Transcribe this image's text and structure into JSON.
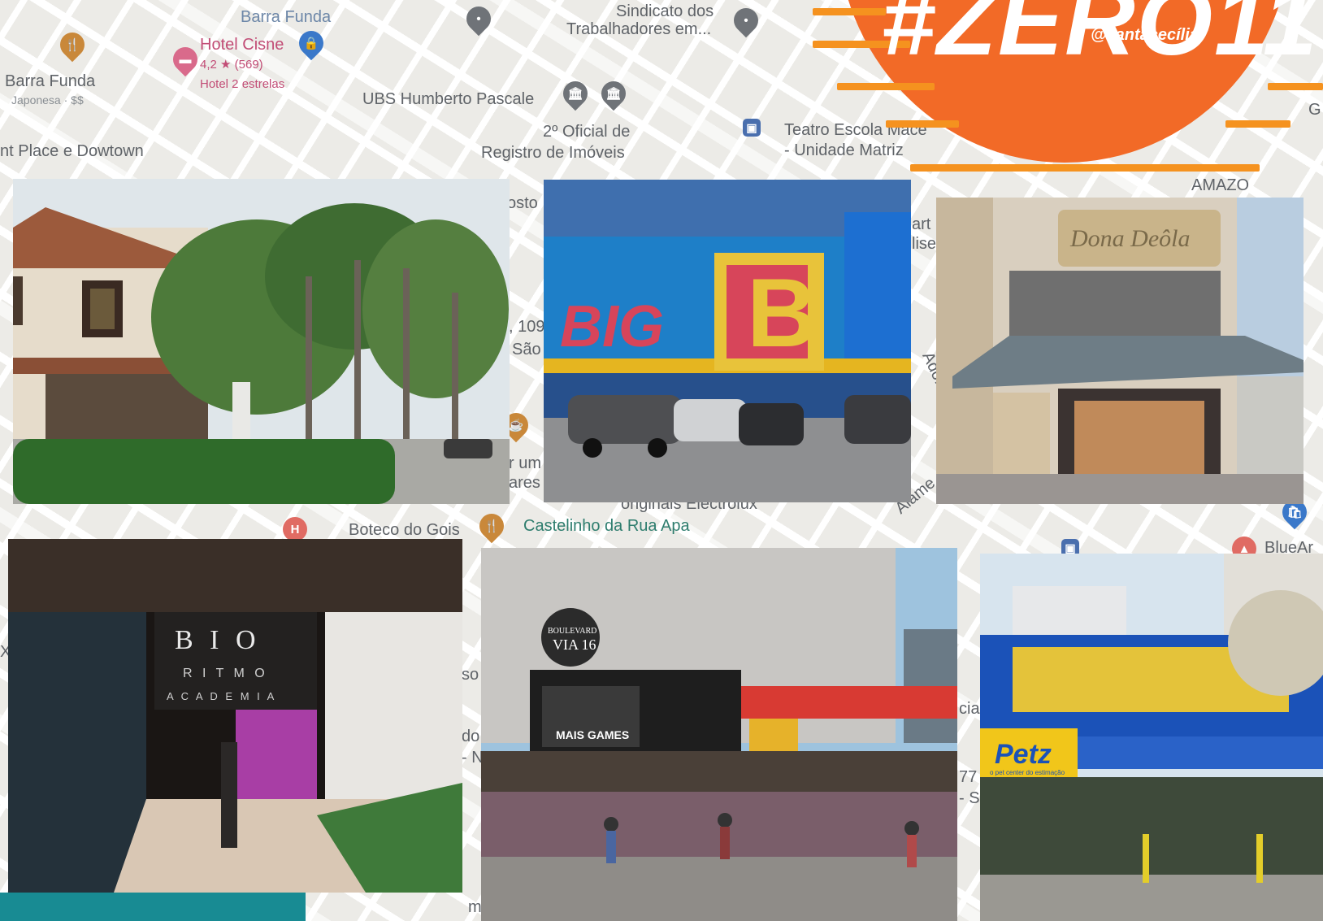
{
  "banner": {
    "title": "#ZERO11",
    "handle": "@santacecília"
  },
  "map": {
    "labels": {
      "barra_funda_top": "Barra Funda",
      "hotel_cisne": "Hotel Cisne",
      "hotel_rating": "4,2 ★ (569)",
      "hotel_stars": "Hotel 2 estrelas",
      "barra_funda_restaurant": "Barra Funda",
      "restaurant_category": "Japonesa · $$",
      "place_downtown": "nt Place e Dowtown",
      "sindicato": "Sindicato dos",
      "trabalhadores": "Trabalhadores em...",
      "ubs": "UBS Humberto Pascale",
      "oficial": "2º Oficial de",
      "registro": "Registro de Imóveis",
      "teatro": "Teatro Escola Mace",
      "unidade": "- Unidade Matriz",
      "amazo": "AMAZO",
      "posto": "osto",
      "art": "art",
      "lise": "lise",
      "num_109": ", 109",
      "sao": "São",
      "adolfo": "Adolfo",
      "um": "r um",
      "ares": "ares",
      "alame": "Alame",
      "originais": "originais Electrolux",
      "boteco": "Boteco do Gois",
      "castelinho": "Castelinho da Rua Apa",
      "bluear": "BlueAr",
      "so": "so",
      "do": "do",
      "n": "- N",
      "cia": "cia",
      "num_77": "77",
      "s": "- S",
      "x": "X",
      "mi": "mi",
      "g": "G"
    }
  },
  "photos": {
    "big_sign": "BIG",
    "big_letter": "B",
    "dona_deola": "Dona Deôla",
    "bio_line1": "B I O",
    "bio_line2": "R I T M O",
    "bio_line3": "A C A D E M I A",
    "boulevard_line1": "BOULEVARD",
    "boulevard_line2": "VIA 16",
    "mais_games": "MAIS GAMES",
    "petz": "Petz",
    "petz_sub": "o pet center do estimação"
  },
  "colors": {
    "banner_orange": "#f26a27",
    "stripe_orange": "#f5921f",
    "teal": "#188b93"
  }
}
